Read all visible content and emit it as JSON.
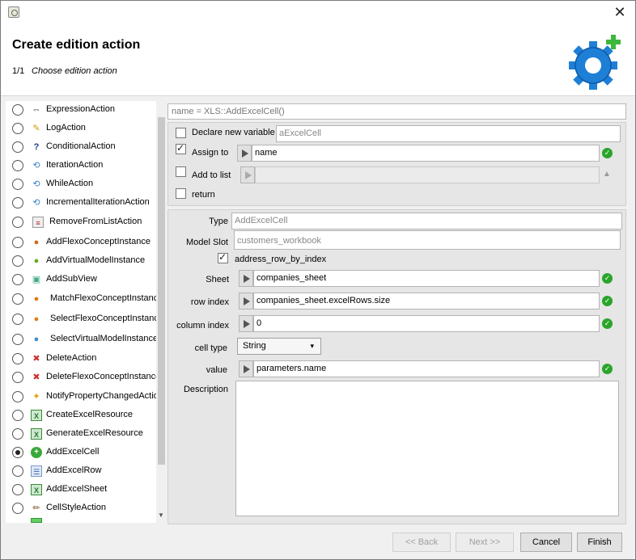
{
  "header": {
    "title": "Create edition action",
    "step": "1/1",
    "step_desc": "Choose edition action"
  },
  "actions": [
    {
      "label": "ExpressionAction",
      "icon": "expression-icon",
      "selected": false
    },
    {
      "label": "LogAction",
      "icon": "pencil-icon",
      "selected": false
    },
    {
      "label": "ConditionalAction",
      "icon": "question-icon",
      "selected": false
    },
    {
      "label": "IterationAction",
      "icon": "loop-icon",
      "selected": false
    },
    {
      "label": "WhileAction",
      "icon": "loop-icon",
      "selected": false
    },
    {
      "label": "IncrementalIterationAction",
      "icon": "loop-icon",
      "selected": false
    },
    {
      "label": "RemoveFromListAction",
      "icon": "remove-list-icon",
      "selected": false
    },
    {
      "label": "AddFlexoConceptInstance",
      "icon": "add-concept-icon",
      "selected": false
    },
    {
      "label": "AddVirtualModelInstance",
      "icon": "add-vm-icon",
      "selected": false
    },
    {
      "label": "AddSubView",
      "icon": "add-subview-icon",
      "selected": false
    },
    {
      "label": "MatchFlexoConceptInstance",
      "icon": "match-icon",
      "selected": false
    },
    {
      "label": "SelectFlexoConceptInstance",
      "icon": "select-concept-icon",
      "selected": false
    },
    {
      "label": "SelectVirtualModelInstance",
      "icon": "select-vm-icon",
      "selected": false
    },
    {
      "label": "DeleteAction",
      "icon": "delete-icon",
      "selected": false
    },
    {
      "label": "DeleteFlexoConceptInstance",
      "icon": "delete-concept-icon",
      "selected": false
    },
    {
      "label": "NotifyPropertyChangedAction",
      "icon": "notify-icon",
      "selected": false
    },
    {
      "label": "CreateExcelResource",
      "icon": "excel-icon",
      "selected": false
    },
    {
      "label": "GenerateExcelResource",
      "icon": "excel-icon",
      "selected": false
    },
    {
      "label": "AddExcelCell",
      "icon": "excel-cell-icon",
      "selected": true
    },
    {
      "label": "AddExcelRow",
      "icon": "excel-row-icon",
      "selected": false
    },
    {
      "label": "AddExcelSheet",
      "icon": "excel-icon",
      "selected": false
    },
    {
      "label": "CellStyleAction",
      "icon": "brush-icon",
      "selected": false
    }
  ],
  "name_field": "name = XLS::AddExcelCell()",
  "declare_var": {
    "label": "Declare new variable",
    "checked": false,
    "value": "aExcelCell"
  },
  "assign_to": {
    "label": "Assign to",
    "checked": true,
    "value": "name"
  },
  "add_to_list": {
    "label": "Add to list",
    "checked": false,
    "value": ""
  },
  "return_opt": {
    "label": "return",
    "checked": false
  },
  "type": {
    "label": "Type",
    "value": "AddExcelCell"
  },
  "model_slot": {
    "label": "Model Slot",
    "value": "customers_workbook"
  },
  "address_row": {
    "label": "address_row_by_index",
    "checked": true
  },
  "sheet": {
    "label": "Sheet",
    "value": "companies_sheet"
  },
  "row_index": {
    "label": "row index",
    "value": "companies_sheet.excelRows.size"
  },
  "column_index": {
    "label": "column index",
    "value": "0"
  },
  "cell_type": {
    "label": "cell type",
    "value": "String"
  },
  "value_field": {
    "label": "value",
    "value": "parameters.name"
  },
  "description": {
    "label": "Description",
    "value": ""
  },
  "buttons": {
    "back": "<< Back",
    "next": "Next >>",
    "cancel": "Cancel",
    "finish": "Finish"
  },
  "colors": {
    "ok_green": "#2aa52a",
    "gear_blue": "#1e7fd6",
    "plus_green": "#3cb83c"
  }
}
